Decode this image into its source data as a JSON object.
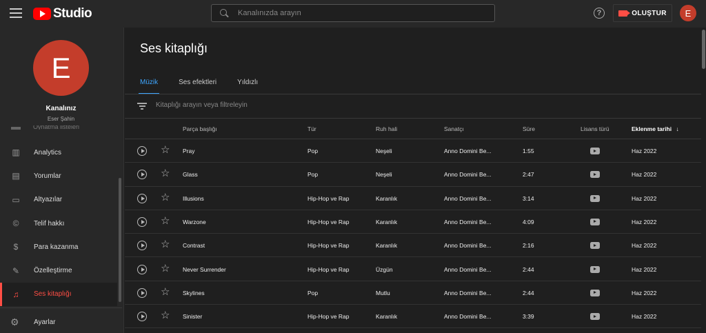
{
  "header": {
    "logo_text": "Studio",
    "search_placeholder": "Kanalınızda arayın",
    "help_label": "?",
    "create_label": "OLUŞTUR",
    "avatar_letter": "E"
  },
  "sidebar": {
    "avatar_letter": "E",
    "channel_name": "Kanalınız",
    "channel_user": "Eser Şahin",
    "cutoff_label": "Oynatma listeleri",
    "items": [
      {
        "label": "Analytics",
        "icon": "analytics-icon",
        "glyph": "▥"
      },
      {
        "label": "Yorumlar",
        "icon": "comments-icon",
        "glyph": "▤"
      },
      {
        "label": "Altyazılar",
        "icon": "subtitles-icon",
        "glyph": "▭"
      },
      {
        "label": "Telif hakkı",
        "icon": "copyright-icon",
        "glyph": "©"
      },
      {
        "label": "Para kazanma",
        "icon": "dollar-icon",
        "glyph": "$"
      },
      {
        "label": "Özelleştirme",
        "icon": "magic-wand-icon",
        "glyph": "✎"
      },
      {
        "label": "Ses kitaplığı",
        "icon": "audio-library-icon",
        "glyph": "♫",
        "active": true
      }
    ],
    "settings_label": "Ayarlar",
    "active_color": "#ff4e45"
  },
  "main": {
    "title": "Ses kitaplığı",
    "tabs": [
      {
        "label": "Müzik",
        "active": true
      },
      {
        "label": "Ses efektleri"
      },
      {
        "label": "Yıldızlı"
      }
    ],
    "filter_placeholder": "Kitaplığı arayın veya filtreleyin",
    "columns": {
      "title": "Parça başlığı",
      "genre": "Tür",
      "mood": "Ruh hali",
      "artist": "Sanatçı",
      "duration": "Süre",
      "license": "Lisans türü",
      "added": "Eklenme tarihi",
      "sort_arrow": "↓"
    },
    "rows": [
      {
        "title": "Pray",
        "genre": "Pop",
        "mood": "Neşeli",
        "artist": "Anno Domini Be...",
        "duration": "1:55",
        "added": "Haz 2022"
      },
      {
        "title": "Glass",
        "genre": "Pop",
        "mood": "Neşeli",
        "artist": "Anno Domini Be...",
        "duration": "2:47",
        "added": "Haz 2022"
      },
      {
        "title": "Illusions",
        "genre": "Hip-Hop ve Rap",
        "mood": "Karanlık",
        "artist": "Anno Domini Be...",
        "duration": "3:14",
        "added": "Haz 2022"
      },
      {
        "title": "Warzone",
        "genre": "Hip-Hop ve Rap",
        "mood": "Karanlık",
        "artist": "Anno Domini Be...",
        "duration": "4:09",
        "added": "Haz 2022"
      },
      {
        "title": "Contrast",
        "genre": "Hip-Hop ve Rap",
        "mood": "Karanlık",
        "artist": "Anno Domini Be...",
        "duration": "2:16",
        "added": "Haz 2022"
      },
      {
        "title": "Never Surrender",
        "genre": "Hip-Hop ve Rap",
        "mood": "Üzgün",
        "artist": "Anno Domini Be...",
        "duration": "2:44",
        "added": "Haz 2022"
      },
      {
        "title": "Skylines",
        "genre": "Pop",
        "mood": "Mutlu",
        "artist": "Anno Domini Be...",
        "duration": "2:44",
        "added": "Haz 2022"
      },
      {
        "title": "Sinister",
        "genre": "Hip-Hop ve Rap",
        "mood": "Karanlık",
        "artist": "Anno Domini Be...",
        "duration": "3:39",
        "added": "Haz 2022"
      }
    ],
    "accent_color": "#3ea6ff"
  }
}
